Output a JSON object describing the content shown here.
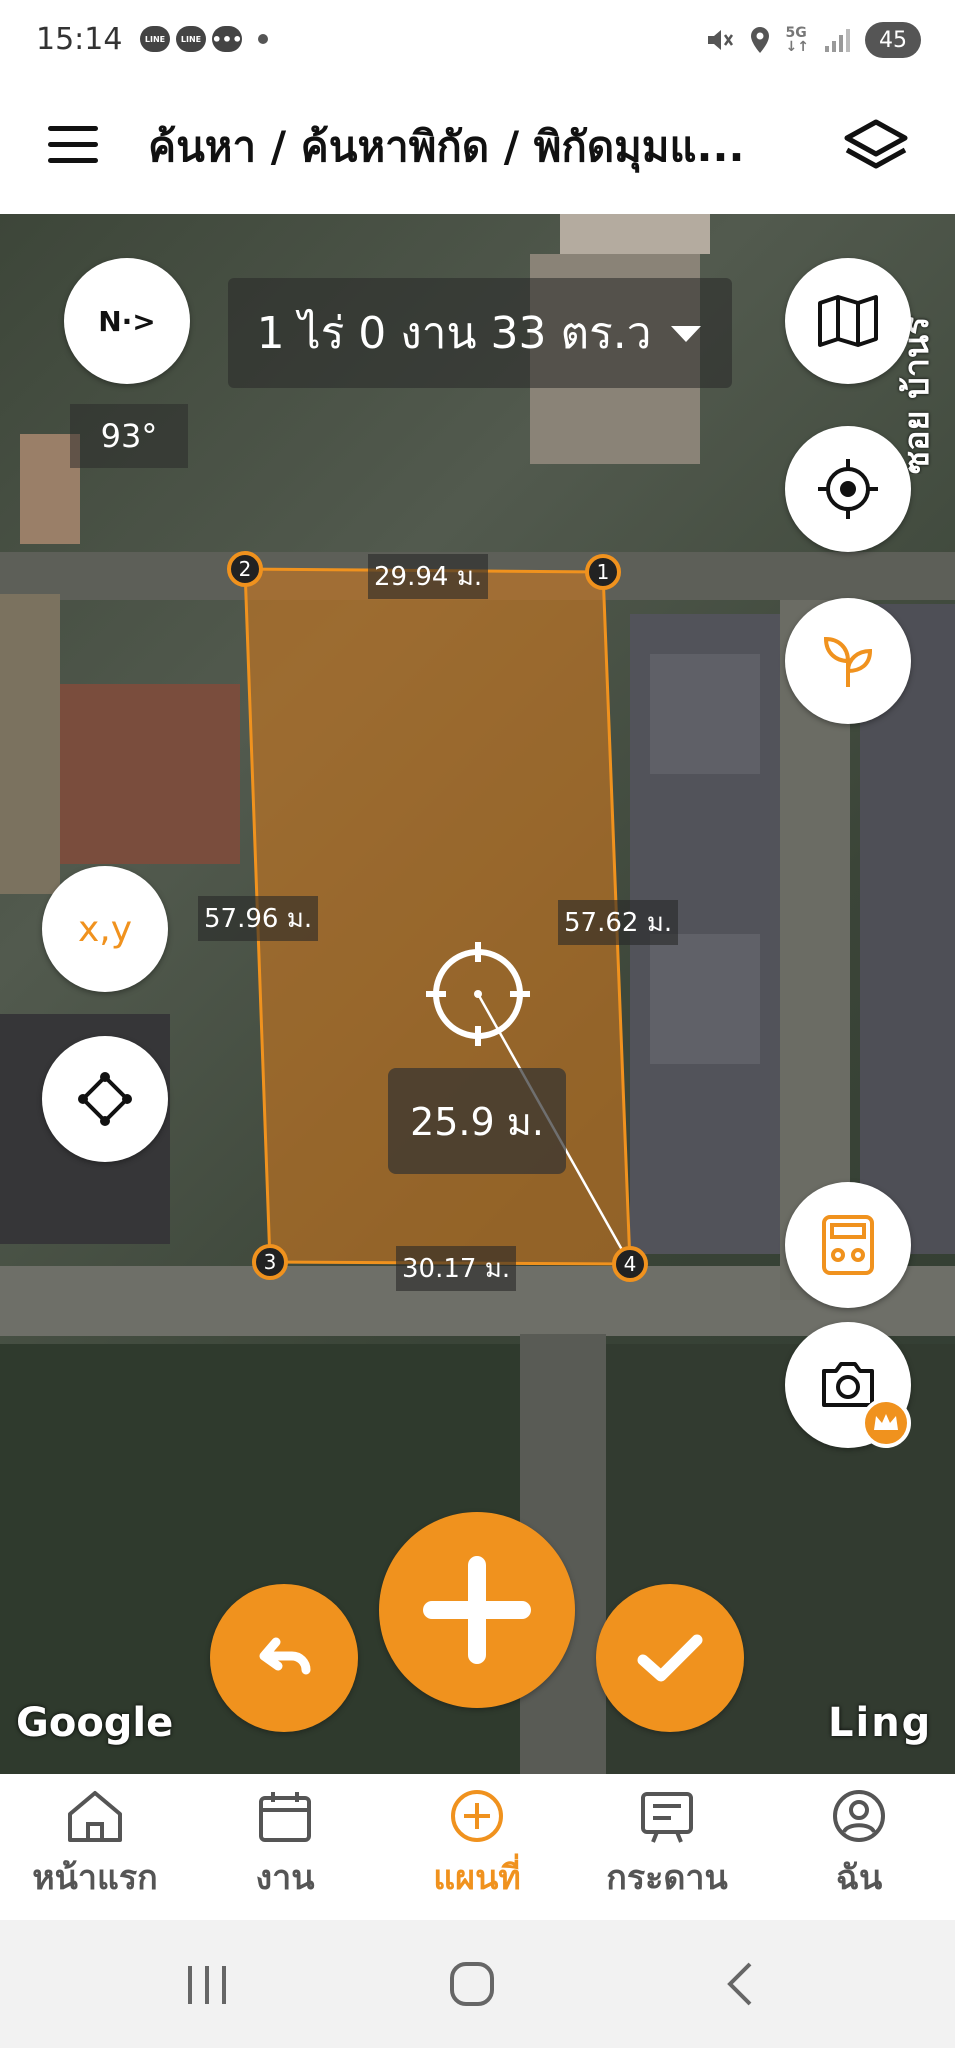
{
  "status_bar": {
    "time": "15:14",
    "notifications": [
      "LINE",
      "LINE",
      "chat"
    ],
    "network": "5G",
    "battery": "45"
  },
  "header": {
    "breadcrumb": "ค้นหา / ค้นหาพิกัด / พิกัดมุมแ...",
    "menu_icon": "hamburger-icon",
    "layers_icon": "layers-icon"
  },
  "map": {
    "compass_label": "N·>",
    "heading": "93°",
    "area_text": "1 ไร่ 0 งาน 33 ตร.ว",
    "street_label": "ซอย บ้านร",
    "measure_distance": "25.9 ม.",
    "corners": [
      {
        "id": "1"
      },
      {
        "id": "2"
      },
      {
        "id": "3"
      },
      {
        "id": "4"
      }
    ],
    "edge_labels": {
      "top": "29.94 ม.",
      "left": "57.96 ม.",
      "right": "57.62 ม.",
      "bottom": "30.17 ม."
    },
    "xy_button_label": "x,y",
    "watermark_left": "Google",
    "watermark_right": "Ling"
  },
  "colors": {
    "accent": "#f0921e",
    "plot_fill": "rgba(207,120,30,0.6)",
    "plot_stroke": "#f0921e"
  },
  "bottom_nav": {
    "items": [
      {
        "label": "หน้าแรก",
        "icon": "home-icon"
      },
      {
        "label": "งาน",
        "icon": "calendar-icon"
      },
      {
        "label": "แผนที่",
        "icon": "plus-circle-icon",
        "active": true
      },
      {
        "label": "กระดาน",
        "icon": "board-icon"
      },
      {
        "label": "ฉัน",
        "icon": "user-icon"
      }
    ]
  },
  "system_nav": [
    "recents",
    "home",
    "back"
  ]
}
